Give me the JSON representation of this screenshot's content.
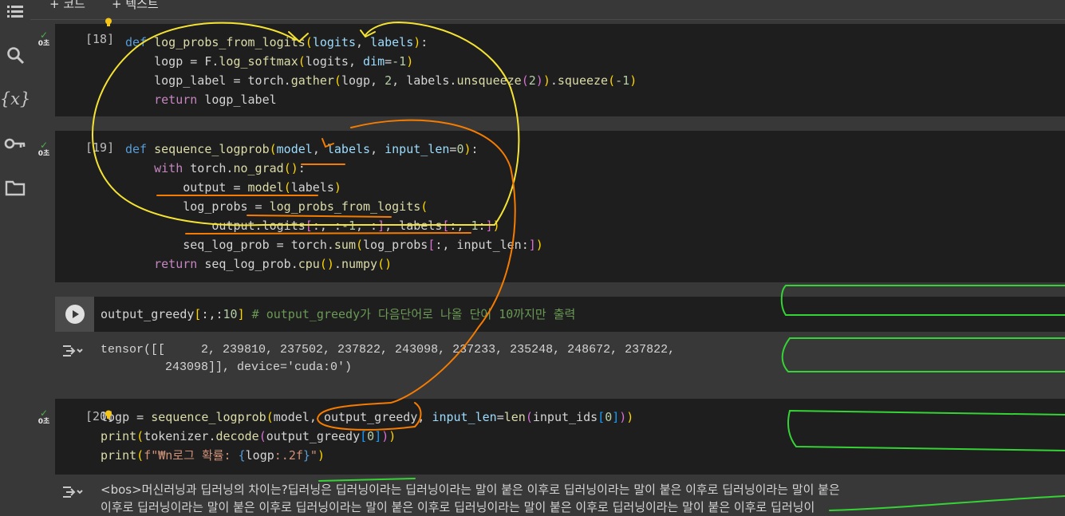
{
  "toolbar": {
    "add_code": "+ 코드",
    "add_text": "+ 텍스트"
  },
  "sidebar": {
    "icons": [
      "toc-icon",
      "search-icon",
      "variables-icon",
      "key-icon",
      "folder-icon"
    ]
  },
  "cells": [
    {
      "count": "[18]",
      "exec_time": "0초",
      "code": "def log_probs_from_logits(logits, labels):\n    logp = F.log_softmax(logits, dim=-1)\n    logp_label = torch.gather(logp, 2, labels.unsqueeze(2)).squeeze(-1)\n    return logp_label"
    },
    {
      "count": "[19]",
      "exec_time": "0초",
      "code": "def sequence_logprob(model, labels, input_len=0):\n    with torch.no_grad():\n        output = model(labels)\n        log_probs = log_probs_from_logits(\n            output.logits[:, :-1, :], labels[:, 1:])\n        seq_log_prob = torch.sum(log_probs[:, input_len:])\n    return seq_log_prob.cpu().numpy()"
    },
    {
      "count": "",
      "code": "output_greedy[:,:10] # output_greedy가 다음단어로 나올 단어 10까지만 출력",
      "output": "tensor([[     2, 239810, 237502, 237822, 243098, 237233, 235248, 248672, 237822,\n         243098]], device='cuda:0')"
    },
    {
      "count": "[20]",
      "exec_time": "0초",
      "code": "logp = sequence_logprob(model, output_greedy, input_len=len(input_ids[0]))\nprint(tokenizer.decode(output_greedy[0]))\nprint(f\"\\n로그 확률: {logp:.2f}\")",
      "output": "<bos>머신러닝과 딥러닝의 차이는?딥러닝은 딥러닝이라는 딥러닝이라는 말이 붙은 이후로 딥러닝이라는 말이 붙은 이후로 딥러닝이라는 말이 붙은\n이후로 딥러닝이라는 말이 붙은 이후로 딥러닝이라는 말이 붙은 이후로 딥러닝이라는 말이 붙은 이후로 딥러닝이라는 말이 붙은 이후로 딥러닝이"
    }
  ]
}
